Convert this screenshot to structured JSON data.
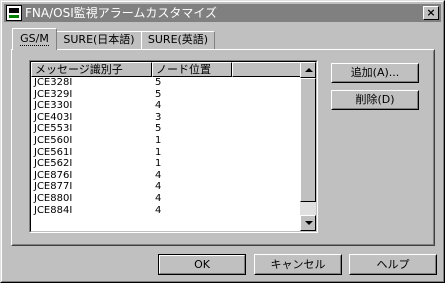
{
  "window": {
    "title": "FNA/OSI監視アラームカスタマイズ",
    "close_glyph": "×"
  },
  "tabs": [
    {
      "label": "GS/M",
      "active": true
    },
    {
      "label": "SURE(日本語)",
      "active": false
    },
    {
      "label": "SURE(英語)",
      "active": false
    }
  ],
  "list": {
    "columns": [
      "メッセージ識別子",
      "ノード位置"
    ],
    "rows": [
      [
        "JCE328I",
        "5"
      ],
      [
        "JCE329I",
        "5"
      ],
      [
        "JCE330I",
        "4"
      ],
      [
        "JCE403I",
        "3"
      ],
      [
        "JCE553I",
        "5"
      ],
      [
        "JCE560I",
        "1"
      ],
      [
        "JCE561I",
        "1"
      ],
      [
        "JCE562I",
        "1"
      ],
      [
        "JCE876I",
        "4"
      ],
      [
        "JCE877I",
        "4"
      ],
      [
        "JCE880I",
        "4"
      ],
      [
        "JCE884I",
        "4"
      ]
    ]
  },
  "side_buttons": {
    "add_label": "追加(A)...",
    "delete_label": "削除(D)"
  },
  "footer_buttons": {
    "ok_label": "OK",
    "cancel_label": "キャンセル",
    "help_label": "ヘルプ"
  }
}
